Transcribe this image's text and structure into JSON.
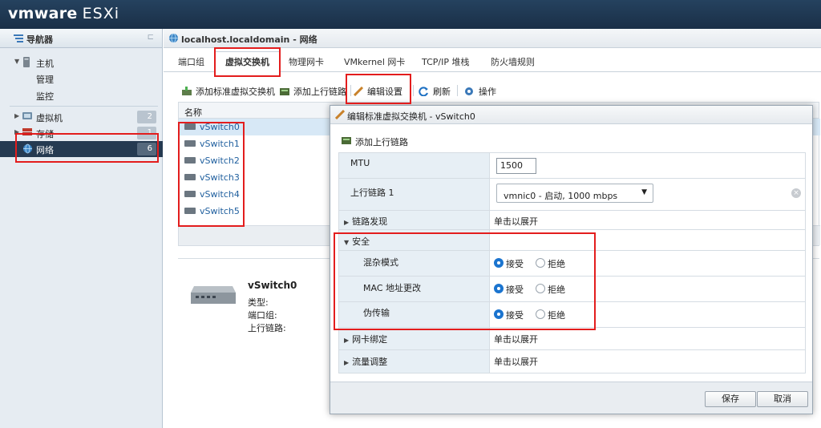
{
  "topbar": {
    "brand": "vmware",
    "product": "ESXi"
  },
  "navigator": {
    "title": "导航器",
    "items": [
      {
        "label": "主机"
      },
      {
        "label": "管理"
      },
      {
        "label": "监控"
      },
      {
        "label": "虚拟机",
        "count": "2"
      },
      {
        "label": "存储",
        "count": "1"
      },
      {
        "label": "网络",
        "count": "6"
      }
    ]
  },
  "main": {
    "title": "localhost.localdomain - 网络",
    "tabs": [
      "端口组",
      "虚拟交换机",
      "物理网卡",
      "VMkernel 网卡",
      "TCP/IP 堆栈",
      "防火墙规则"
    ],
    "active_tab": "虚拟交换机",
    "toolbar": {
      "add_std_switch": "添加标准虚拟交换机",
      "add_uplink": "添加上行链路",
      "edit_settings": "编辑设置",
      "refresh": "刷新",
      "actions": "操作"
    },
    "grid": {
      "column": "名称",
      "rows": [
        "vSwitch0",
        "vSwitch1",
        "vSwitch2",
        "vSwitch3",
        "vSwitch4",
        "vSwitch5"
      ]
    },
    "detail": {
      "name": "vSwitch0",
      "type_label": "类型:",
      "portgroups_label": "端口组:",
      "uplinks_label": "上行链路:"
    }
  },
  "dialog": {
    "title": "编辑标准虚拟交换机 - vSwitch0",
    "add_uplink": "添加上行链路",
    "mtu_label": "MTU",
    "mtu_value": "1500",
    "uplink_label": "上行链路 1",
    "uplink_value": "vmnic0 - 启动, 1000 mbps",
    "link_discovery_label": "链路发现",
    "expand_hint": "单击以展开",
    "security_label": "安全",
    "promiscuous_label": "混杂模式",
    "mac_change_label": "MAC 地址更改",
    "forged_label": "伪传输",
    "accept": "接受",
    "reject": "拒绝",
    "nic_teaming_label": "网卡绑定",
    "traffic_shaping_label": "流量调整",
    "save": "保存",
    "cancel": "取消"
  },
  "colors": {
    "highlight": "#e31d1d",
    "topbar": "#1f3850",
    "nav_selected": "#253a51",
    "radio_on": "#1b74cf"
  }
}
